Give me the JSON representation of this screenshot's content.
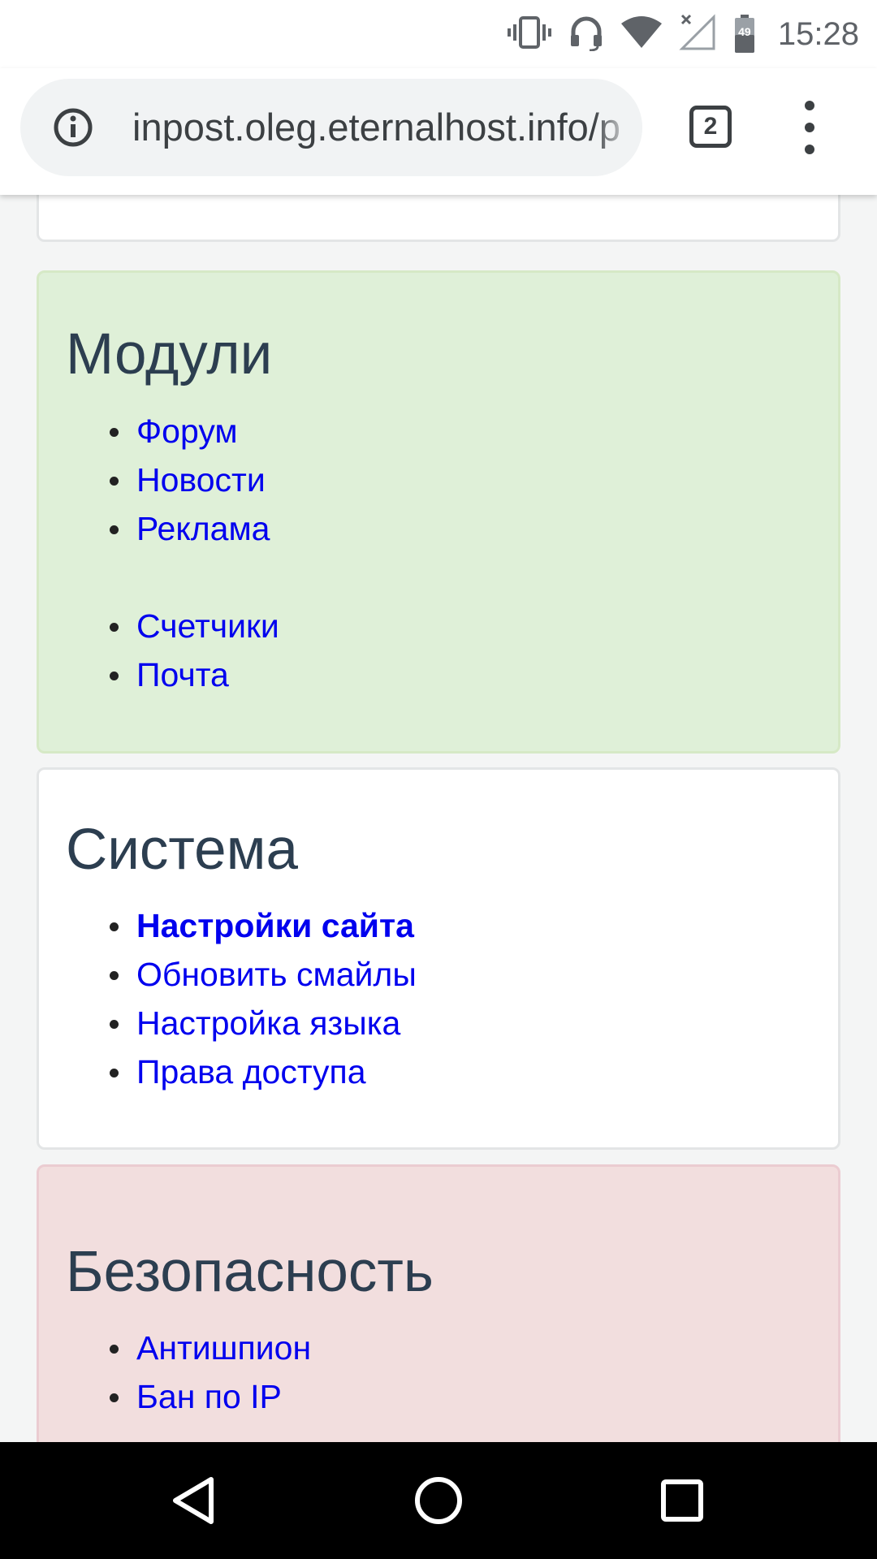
{
  "status_bar": {
    "time": "15:28",
    "battery_level": "49",
    "icons": [
      "vibrate-icon",
      "headset-icon",
      "wifi-icon",
      "signal-off-icon",
      "battery-icon"
    ]
  },
  "browser": {
    "url": "inpost.oleg.eternalhost.info/p",
    "tab_count": "2",
    "icons": [
      "info-icon",
      "tab-switcher-icon",
      "overflow-menu-icon"
    ]
  },
  "sections": {
    "modules": {
      "title": "Модули",
      "links": [
        "Форум",
        "Новости",
        "Реклама",
        "Счетчики",
        "Почта"
      ],
      "color": "#dff0d8"
    },
    "system": {
      "title": "Система",
      "links": [
        "Настройки сайта",
        "Обновить смайлы",
        "Настройка языка",
        "Права доступа"
      ],
      "color": "#ffffff"
    },
    "security": {
      "title": "Безопасность",
      "links": [
        "Антишпион",
        "Бан по IP"
      ],
      "color": "#f2dede"
    }
  },
  "nav_bar": {
    "icons": [
      "back-icon",
      "home-icon",
      "recents-icon"
    ]
  },
  "colors": {
    "link": "#0000ee",
    "heading": "#2c3e50"
  }
}
